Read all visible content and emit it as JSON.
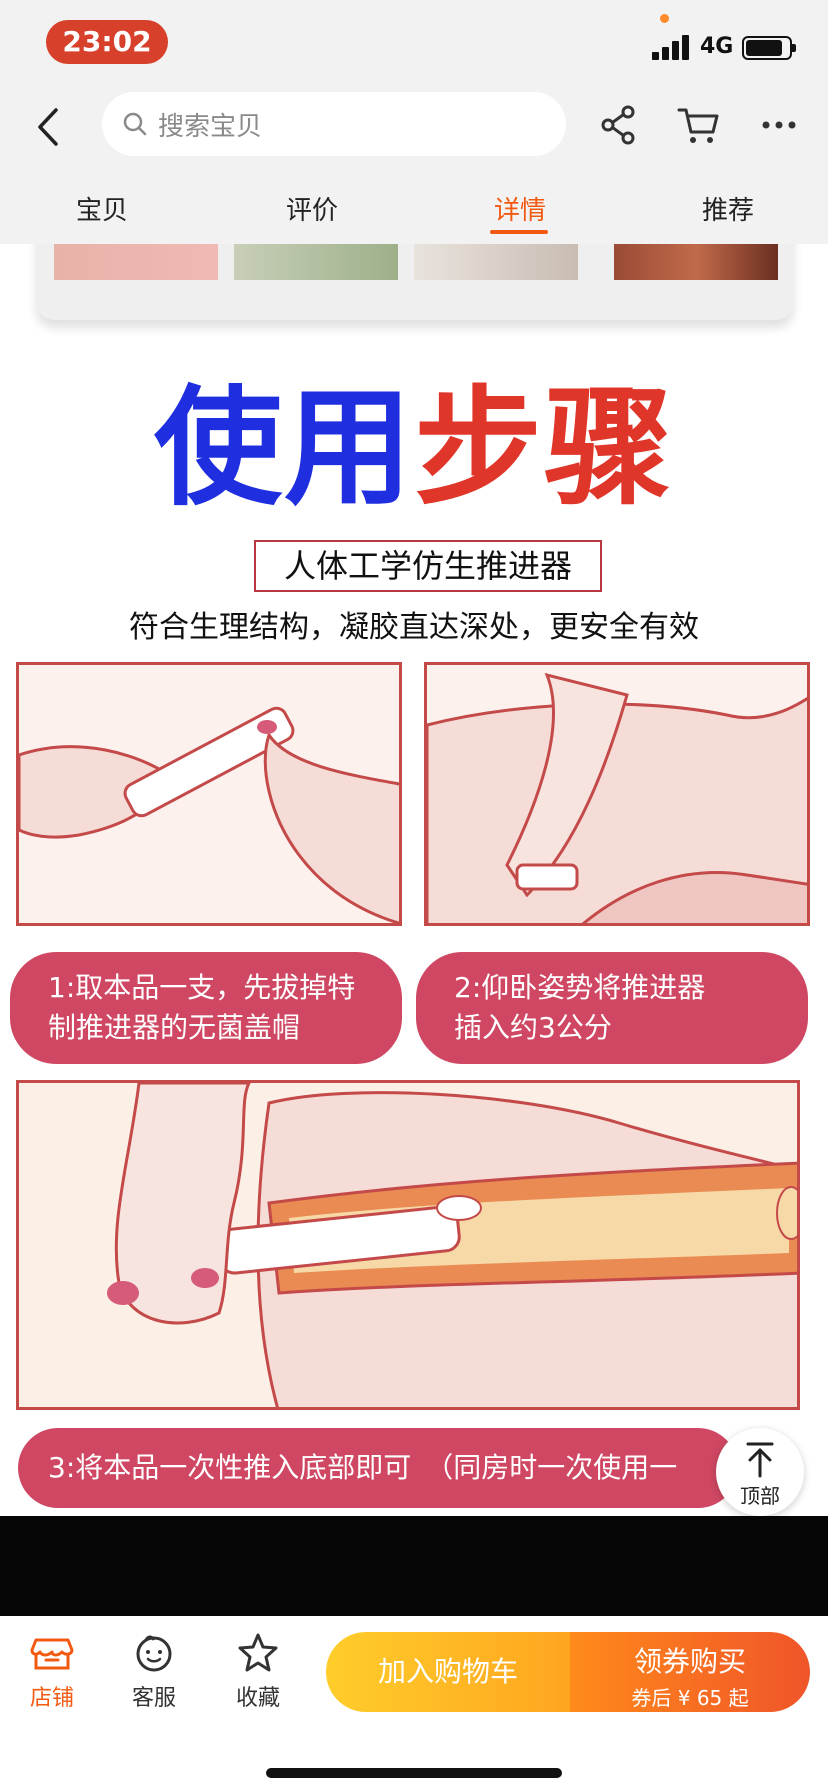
{
  "status_bar": {
    "time": "23:02",
    "network": "4G"
  },
  "nav": {
    "search_placeholder": "搜索宝贝"
  },
  "tabs": [
    {
      "label": "宝贝",
      "active": false
    },
    {
      "label": "评价",
      "active": false
    },
    {
      "label": "详情",
      "active": true
    },
    {
      "label": "推荐",
      "active": false
    }
  ],
  "content": {
    "title_part1": "使用",
    "title_part2": "步骤",
    "subtitle": "人体工学仿生推进器",
    "subtitle2": "符合生理结构，凝胶直达深处，更安全有效",
    "step1": [
      "1:取本品一支，先拔掉特",
      "制推进器的无菌盖帽"
    ],
    "step2": [
      "2:仰卧姿势将推进器",
      "插入约3公分"
    ],
    "step3": "3:将本品一次性推入底部即可　（同房时一次使用一"
  },
  "top_button": {
    "label": "顶部"
  },
  "bottom_bar": {
    "shop": "店铺",
    "service": "客服",
    "favorite": "收藏",
    "add_to_cart": "加入购物车",
    "buy": "领券购买",
    "buy_price": "券后 ¥ 65 起"
  },
  "colors": {
    "accent": "#f25a12",
    "pill": "#cf4762",
    "title_blue": "#1f2fe0",
    "title_red": "#e0362a"
  }
}
